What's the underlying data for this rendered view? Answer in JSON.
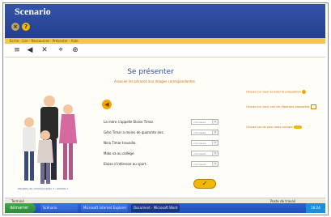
{
  "app": {
    "title": "Scenario"
  },
  "menubar": {
    "text": "Ecrire · Lire · Ressources · Présenter · Aide"
  },
  "page": {
    "title": "Se présenter",
    "instruction": "Associer les phrases aux images correspondantes"
  },
  "activity": {
    "speaker_icon": "speaker-icon",
    "rows": [
      {
        "sentence": "La mère s'appelle Eloise Timar.",
        "select_value": "choisissez"
      },
      {
        "sentence": "Géro Timar a moins de quarante ans.",
        "select_value": "choisissez"
      },
      {
        "sentence": "Nina Timar travaille.",
        "select_value": "choisissez"
      },
      {
        "sentence": "Malo va au collège.",
        "select_value": "choisissez"
      },
      {
        "sentence": "Eloise s'intéresse au sport.",
        "select_value": "choisissez"
      }
    ],
    "validate_icon": "check-icon",
    "caption": "Situation de communication 1 · activité 1"
  },
  "hints": [
    {
      "text": "Cliquez sur pour écouter la proposition"
    },
    {
      "text": "Cliquez sur pour voir les réponses proposées"
    },
    {
      "text": "Cliquez sur ok pour vous corriger"
    }
  ],
  "statusbar": {
    "left": "Terminé",
    "right": "Poste de travail"
  },
  "taskbar": {
    "start_label": "démarrer",
    "buttons": [
      {
        "label": "Scénario"
      },
      {
        "label": "Microsoft Internet Explorer"
      },
      {
        "label": "Document - Microsoft Word"
      }
    ],
    "clock": "16:24"
  },
  "colors": {
    "header": "#2a4698",
    "menubar": "#f3c64a",
    "accent_orange": "#d46a00",
    "title_blue": "#2b4aa0",
    "taskbar_blue": "#2a63d8",
    "start_green": "#2e8a3a"
  }
}
